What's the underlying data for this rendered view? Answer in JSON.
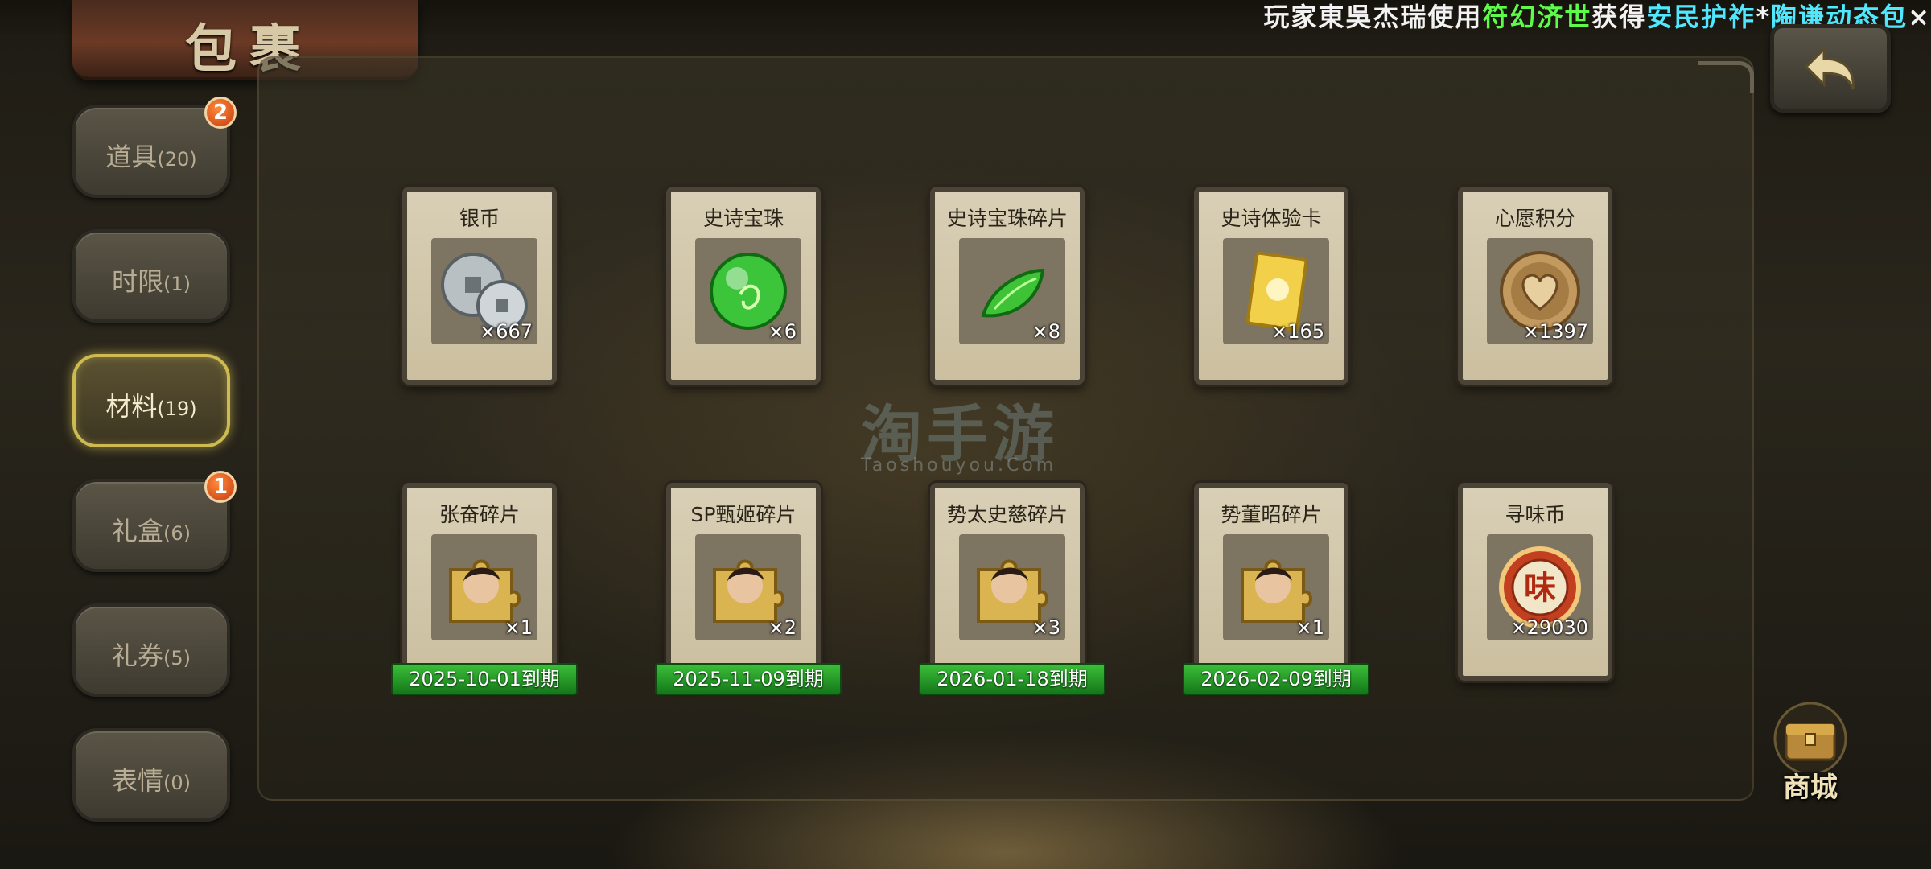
{
  "ticker": {
    "prefix": "玩家",
    "player": "東吳杰瑞",
    "verb": "使用",
    "item": "符幻济世",
    "got": "获得",
    "reward": "安民护祚",
    "separator": "*",
    "reward2": "陶谦动态包",
    "tail": "×"
  },
  "title": "包裹",
  "sidebar": [
    {
      "label": "道具",
      "count": "(20)",
      "badge": "2",
      "active": false
    },
    {
      "label": "时限",
      "count": "(1)",
      "badge": "",
      "active": false
    },
    {
      "label": "材料",
      "count": "(19)",
      "badge": "",
      "active": true
    },
    {
      "label": "礼盒",
      "count": "(6)",
      "badge": "1",
      "active": false
    },
    {
      "label": "礼券",
      "count": "(5)",
      "badge": "",
      "active": false
    },
    {
      "label": "表情",
      "count": "(0)",
      "badge": "",
      "active": false
    }
  ],
  "items": [
    {
      "name": "银币",
      "qty": "×667",
      "icon": "silver-coin-icon",
      "expiry": ""
    },
    {
      "name": "史诗宝珠",
      "qty": "×6",
      "icon": "epic-orb-icon",
      "expiry": ""
    },
    {
      "name": "史诗宝珠碎片",
      "qty": "×8",
      "icon": "orb-fragment-icon",
      "expiry": ""
    },
    {
      "name": "史诗体验卡",
      "qty": "×165",
      "icon": "experience-card-icon",
      "expiry": ""
    },
    {
      "name": "心愿积分",
      "qty": "×1397",
      "icon": "wish-points-coin-icon",
      "expiry": ""
    },
    {
      "name": "张奋碎片",
      "qty": "×1",
      "icon": "hero-puzzle-icon",
      "expiry": "2025-10-01到期"
    },
    {
      "name": "SP甄姬碎片",
      "qty": "×2",
      "icon": "hero-puzzle-icon",
      "expiry": "2025-11-09到期"
    },
    {
      "name": "势太史慈碎片",
      "qty": "×3",
      "icon": "hero-puzzle-icon",
      "expiry": "2026-01-18到期"
    },
    {
      "name": "势董昭碎片",
      "qty": "×1",
      "icon": "hero-puzzle-icon",
      "expiry": "2026-02-09到期"
    },
    {
      "name": "寻味币",
      "qty": "×29030",
      "icon": "flavor-coin-icon",
      "coin_glyph": "味",
      "expiry": ""
    }
  ],
  "watermark": {
    "main": "淘手游",
    "sub": "Taoshouyou.Com"
  },
  "shop": {
    "label": "商城"
  },
  "colors": {
    "expiry_green": "#2aa12d",
    "active_tab": "#cdbb52",
    "ticker_green": "#5dfb4a",
    "ticker_cyan": "#4fe8ff"
  }
}
